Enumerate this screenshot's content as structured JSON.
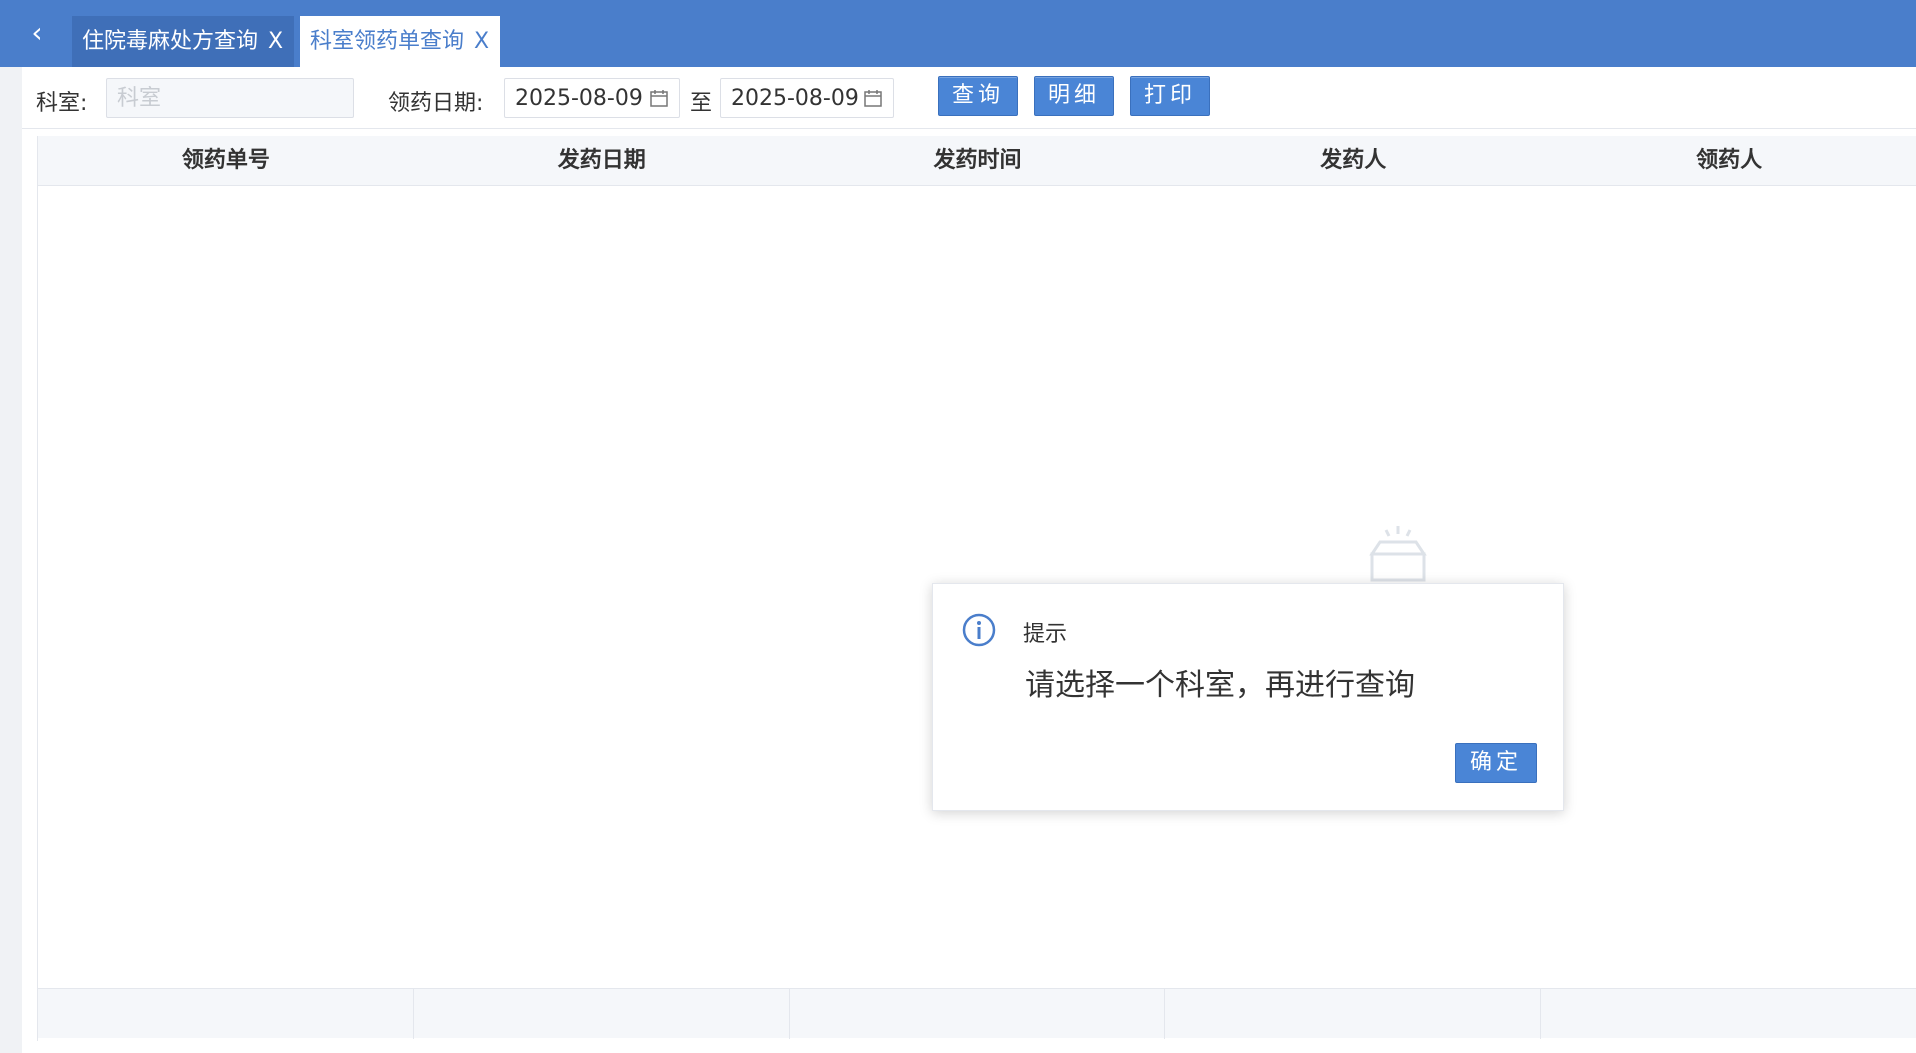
{
  "tabs": [
    {
      "label": "住院毒麻处方查询",
      "close": "X"
    },
    {
      "label": "科室领药单查询",
      "close": "X"
    }
  ],
  "toolbar": {
    "dept_label": "科室:",
    "dept_placeholder": "科室",
    "date_label": "领药日期:",
    "date_from": "2025-08-09",
    "to_label": "至",
    "date_to": "2025-08-09",
    "query_button": "查询",
    "detail_button": "明细",
    "print_button": "打印"
  },
  "table": {
    "columns": [
      "领药单号",
      "发药日期",
      "发药时间",
      "发药人",
      "领药人"
    ]
  },
  "dialog": {
    "title": "提示",
    "message": "请选择一个科室，再进行查询",
    "ok_button": "确定"
  },
  "colors": {
    "header_blue": "#4a7ecb",
    "button_blue": "#4a85d6"
  }
}
